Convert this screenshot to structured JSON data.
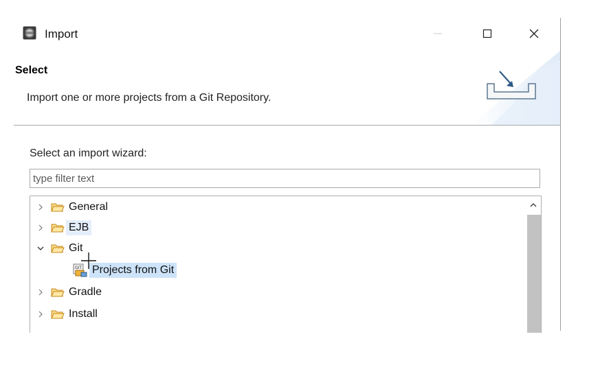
{
  "window": {
    "title": "Import",
    "app_icon": "eclipse-icon",
    "controls": [
      "minimize-icon",
      "maximize-icon",
      "close-icon"
    ]
  },
  "header": {
    "title": "Select",
    "description": "Import one or more projects from a Git Repository.",
    "banner_icon": "import-tray-icon"
  },
  "body": {
    "wizard_label": "Select an import wizard:",
    "filter": {
      "placeholder": "type filter text",
      "value": ""
    },
    "tree": {
      "items": [
        {
          "label": "General",
          "expanded": false,
          "icon": "folder-icon",
          "level": 0
        },
        {
          "label": "EJB",
          "expanded": false,
          "icon": "folder-icon",
          "level": 0,
          "highlight": "hover"
        },
        {
          "label": "Git",
          "expanded": true,
          "icon": "folder-icon",
          "level": 0
        },
        {
          "label": "Projects from Git",
          "icon": "git-project-icon",
          "level": 1,
          "selected": true
        },
        {
          "label": "Gradle",
          "expanded": false,
          "icon": "folder-icon",
          "level": 0
        },
        {
          "label": "Install",
          "expanded": false,
          "icon": "folder-icon",
          "level": 0
        }
      ]
    }
  },
  "colors": {
    "selection": "#cde3f9",
    "hover": "#e4eefb",
    "folder": "#e8a93a",
    "separator": "#a8a8a8"
  }
}
